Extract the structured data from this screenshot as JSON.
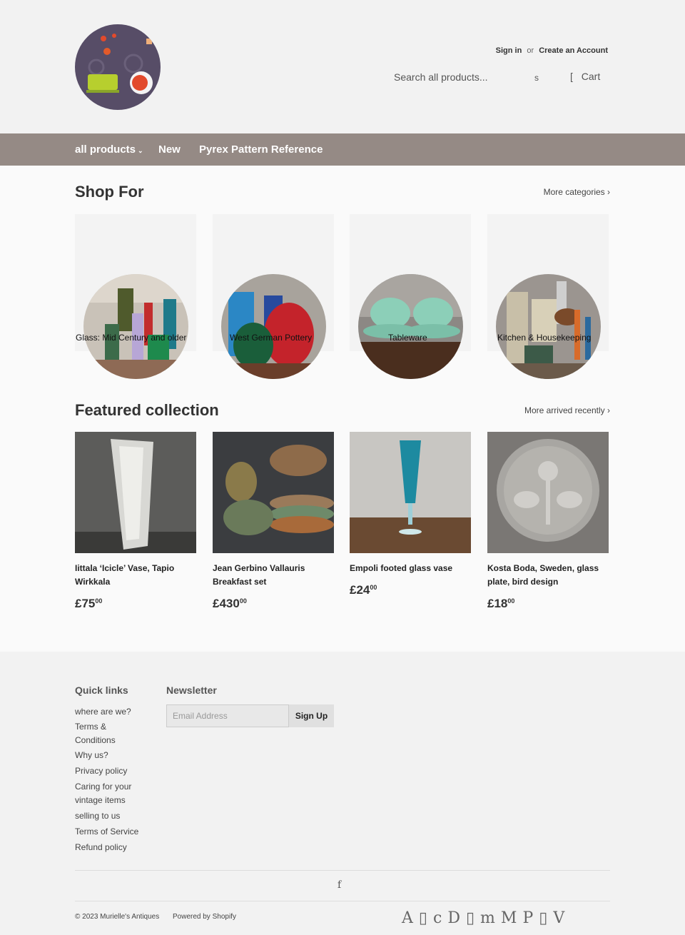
{
  "header": {
    "sign_in": "Sign in",
    "or": "or",
    "create_account": "Create an Account",
    "search_placeholder": "Search all products...",
    "search_icon_glyph": "s",
    "cart_bracket": "[",
    "cart": "Cart"
  },
  "nav": {
    "items": [
      {
        "label": "all products",
        "caret": "⌄"
      },
      {
        "label": "New"
      },
      {
        "label": "Pyrex Pattern Reference"
      }
    ]
  },
  "shop_for": {
    "title": "Shop For",
    "more": "More categories ›",
    "categories": [
      {
        "label": "Glass: Mid Century and older"
      },
      {
        "label": "West German Pottery"
      },
      {
        "label": "Tableware"
      },
      {
        "label": "Kitchen & Housekeeping"
      }
    ]
  },
  "featured": {
    "title": "Featured collection",
    "more": "More arrived recently ›",
    "products": [
      {
        "title": "Iittala ‘Icicle’ Vase, Tapio Wirkkala",
        "price": "£75",
        "cents": "00"
      },
      {
        "title": "Jean Gerbino Vallauris Breakfast set",
        "price": "£430",
        "cents": "00"
      },
      {
        "title": "Empoli footed glass vase",
        "price": "£24",
        "cents": "00"
      },
      {
        "title": "Kosta Boda, Sweden, glass plate, bird design",
        "price": "£18",
        "cents": "00"
      }
    ]
  },
  "footer": {
    "quick_links_title": "Quick links",
    "links": [
      "where are we?",
      "Terms & Conditions",
      "Why us?",
      "Privacy policy",
      "Caring for your vintage items",
      "selling to us",
      "Terms of Service",
      "Refund policy"
    ],
    "newsletter_title": "Newsletter",
    "email_placeholder": "Email Address",
    "signup": "Sign Up",
    "facebook_glyph": "f",
    "copyright": "© 2023 Murielle's Antiques",
    "powered": "Powered by Shopify",
    "payment_glyphs": "A▯cD▯mMP▯V"
  },
  "colors": {
    "nav_bg": "#958a85",
    "logo_bg": "#574d67",
    "header_bg": "#f2f2f2"
  }
}
